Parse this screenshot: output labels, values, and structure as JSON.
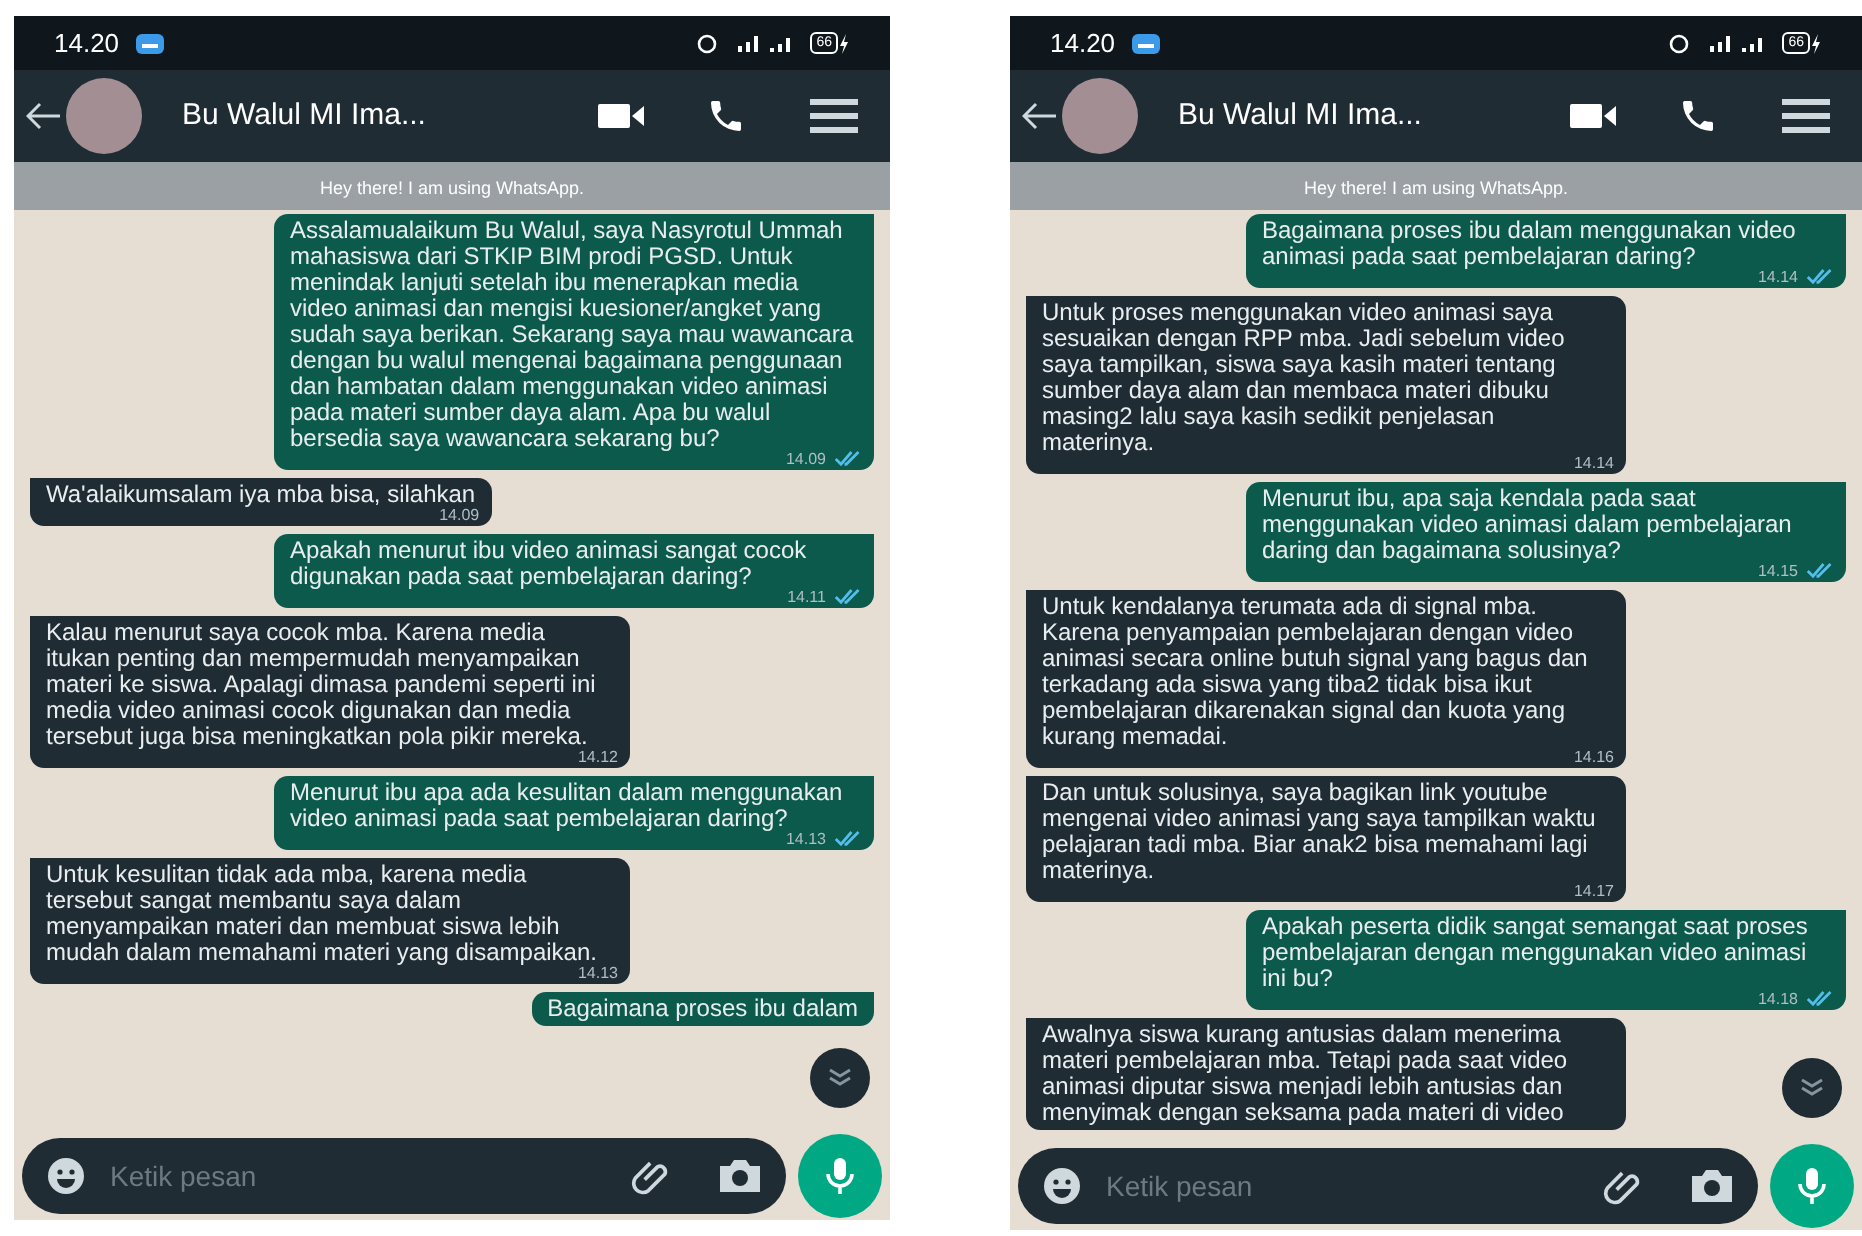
{
  "phones": [
    {
      "status_bar": {
        "time": "14.20",
        "battery": "66"
      },
      "header": {
        "contact": "Bu Walul MI Ima...",
        "status": "Hey there! I am using WhatsApp."
      },
      "messages": [
        {
          "kind": "sent",
          "text": "Assalamualaikum Bu Walul, saya Nasyrotul Ummah mahasiswa dari STKIP BIM prodi PGSD. Untuk menindak lanjuti setelah ibu menerapkan media video animasi dan mengisi kuesioner/angket yang sudah saya berikan. Sekarang saya mau wawancara dengan bu walul mengenai bagaimana penggunaan dan hambatan dalam menggunakan video animasi pada materi sumber daya alam. Apa bu walul bersedia saya wawancara sekarang bu?",
          "time": "14.09",
          "read": true
        },
        {
          "kind": "received",
          "text": "Wa'alaikumsalam iya mba bisa, silahkan",
          "time": "14.09"
        },
        {
          "kind": "sent",
          "text": "Apakah menurut ibu video animasi sangat cocok digunakan pada saat pembelajaran daring?",
          "time": "14.11",
          "read": true
        },
        {
          "kind": "received",
          "text": "Kalau menurut saya cocok mba. Karena media itukan penting dan mempermudah menyampaikan materi ke siswa. Apalagi dimasa pandemi seperti ini media video animasi cocok digunakan dan media tersebut juga bisa meningkatkan pola pikir mereka.",
          "time": "14.12"
        },
        {
          "kind": "sent",
          "text": "Menurut ibu apa ada kesulitan dalam menggunakan video animasi pada saat pembelajaran daring?",
          "time": "14.13",
          "read": true
        },
        {
          "kind": "received",
          "text": "Untuk kesulitan tidak ada mba, karena media tersebut sangat membantu saya dalam menyampaikan materi dan membuat siswa lebih mudah dalam memahami materi yang disampaikan.",
          "time": "14.13"
        },
        {
          "kind": "sent",
          "text": "Bagaimana proses ibu dalam"
        }
      ],
      "composer": {
        "placeholder": "Ketik pesan"
      }
    },
    {
      "status_bar": {
        "time": "14.20",
        "battery": "66"
      },
      "header": {
        "contact": "Bu Walul MI Ima...",
        "status": "Hey there! I am using WhatsApp."
      },
      "messages": [
        {
          "kind": "sent",
          "text": "Bagaimana proses ibu dalam menggunakan video animasi pada saat pembelajaran daring?",
          "time": "14.14",
          "read": true
        },
        {
          "kind": "received",
          "text": "Untuk proses menggunakan video animasi saya sesuaikan dengan RPP mba. Jadi sebelum video saya tampilkan, siswa saya kasih materi tentang sumber daya alam dan membaca materi dibuku masing2 lalu saya kasih sedikit penjelasan materinya.",
          "time": "14.14"
        },
        {
          "kind": "sent",
          "text": "Menurut ibu, apa saja kendala pada saat menggunakan video animasi dalam pembelajaran daring dan bagaimana solusinya?",
          "time": "14.15",
          "read": true
        },
        {
          "kind": "received",
          "text": "Untuk kendalanya terumata ada di signal mba. Karena penyampaian pembelajaran dengan video animasi secara online butuh signal yang bagus dan terkadang ada siswa yang tiba2 tidak bisa ikut pembelajaran dikarenakan signal dan kuota yang kurang memadai.",
          "time": "14.16"
        },
        {
          "kind": "received",
          "text": "Dan untuk solusinya, saya bagikan link youtube mengenai video animasi yang saya tampilkan waktu pelajaran tadi mba. Biar anak2 bisa memahami lagi materinya.",
          "time": "14.17"
        },
        {
          "kind": "sent",
          "text": "Apakah peserta didik sangat semangat saat proses pembelajaran dengan menggunakan video animasi ini bu?",
          "time": "14.18",
          "read": true
        },
        {
          "kind": "received",
          "text": "Awalnya siswa kurang antusias dalam menerima materi pembelajaran mba. Tetapi pada saat video animasi diputar siswa menjadi lebih antusias dan menyimak dengan seksama pada materi di video"
        }
      ],
      "composer": {
        "placeholder": "Ketik pesan"
      }
    }
  ]
}
